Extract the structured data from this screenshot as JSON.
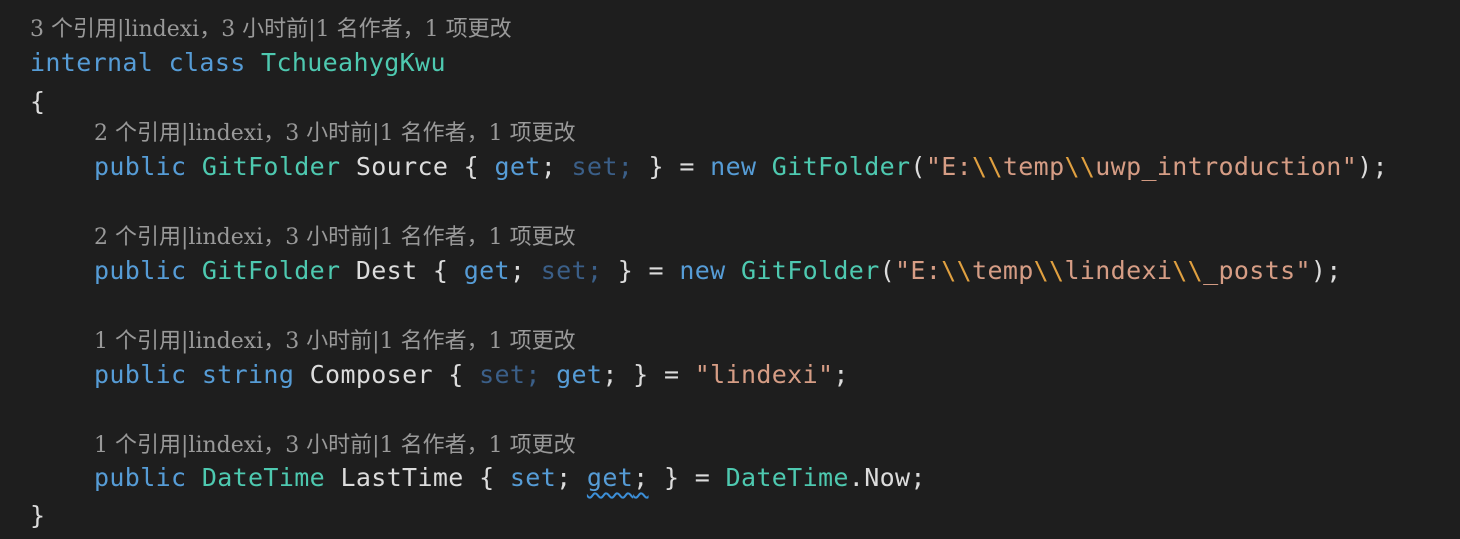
{
  "colors": {
    "background": "#1e1e1e",
    "keyword": "#569cd6",
    "type": "#4ec9b0",
    "identifier": "#dcdcdc",
    "string": "#d69d85",
    "escape": "#e0a040",
    "codelens": "#999999"
  },
  "class_decl": {
    "codelens": "3 个引用|lindexi，3 小时前|1 名作者，1 项更改",
    "modifier": "internal",
    "class_keyword": "class",
    "name": "TchueahygKwu",
    "open_brace": "{",
    "close_brace": "}"
  },
  "members": [
    {
      "codelens": "2 个引用|lindexi，3 小时前|1 名作者，1 项更改",
      "modifier": "public",
      "type": "GitFolder",
      "name": "Source",
      "accessor1": "get",
      "accessor2": "set",
      "new_keyword": "new",
      "init_type": "GitFolder",
      "str_a": "\"E:",
      "esc_a": "\\\\",
      "str_b": "temp",
      "esc_b": "\\\\",
      "str_c": "uwp_introduction\""
    },
    {
      "codelens": "2 个引用|lindexi，3 小时前|1 名作者，1 项更改",
      "modifier": "public",
      "type": "GitFolder",
      "name": "Dest",
      "accessor1": "get",
      "accessor2": "set",
      "new_keyword": "new",
      "init_type": "GitFolder",
      "str_a": "\"E:",
      "esc_a": "\\\\",
      "str_b": "temp",
      "esc_b": "\\\\",
      "str_c": "lindexi",
      "esc_c": "\\\\",
      "str_d": "_posts\""
    },
    {
      "codelens": "1 个引用|lindexi，3 小时前|1 名作者，1 项更改",
      "modifier": "public",
      "type": "string",
      "name": "Composer",
      "accessor1": "set",
      "accessor2": "get",
      "init_string": "\"lindexi\""
    },
    {
      "codelens": "1 个引用|lindexi，3 小时前|1 名作者，1 项更改",
      "modifier": "public",
      "type": "DateTime",
      "name": "LastTime",
      "accessor1": "set",
      "accessor2": "get",
      "init_type": "DateTime",
      "init_member": "Now"
    }
  ]
}
